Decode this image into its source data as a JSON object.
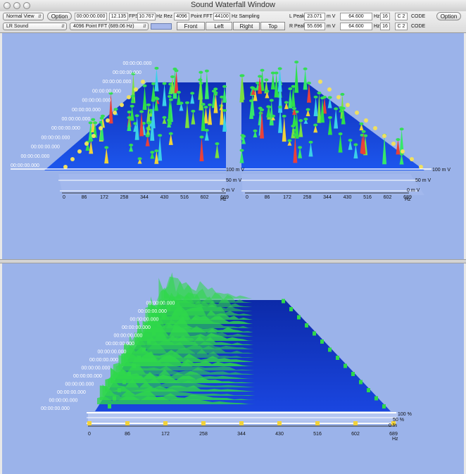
{
  "window": {
    "title": "Sound Waterfall Window"
  },
  "toolbar": {
    "view_mode": "Normal View",
    "option_left": "Option",
    "option_right": "Option",
    "time": "00:00:00.000",
    "fps_value": "12.135",
    "fps_unit": "FPS",
    "hz_rez_value": "10.767",
    "hz_rez_unit": "Hz Rez",
    "fft_points": "4096",
    "fft_unit": "Point FFT",
    "sampling_value": "44100",
    "sampling_unit": "Hz Sampling",
    "source": "LR Sound",
    "fft_select": "4096 Point FFT (689.06 Hz)",
    "views": [
      "Front",
      "Left",
      "Right",
      "Top"
    ],
    "l_peak_label": "L Peak",
    "l_peak_value": "23.071",
    "r_peak_label": "R Peak",
    "r_peak_value": "55.696",
    "mv_unit": "m V",
    "l_hz_value": "64.600",
    "r_hz_value": "64.600",
    "hz_unit": "Hz",
    "l_bands": "16",
    "r_bands": "16",
    "l_note": "C 2",
    "r_note": "C 2",
    "code_label": "CODE",
    "swatch_color": "#a7b8ea"
  },
  "top_plot": {
    "timestamp": "00:00:00.000",
    "x_ticks": [
      "0",
      "86",
      "172",
      "258",
      "344",
      "430",
      "516",
      "602",
      "689"
    ],
    "x_unit": "Hz",
    "level_labels": [
      "100 m V",
      "50 m V",
      "0 m V"
    ],
    "background_color": "#9bb3ea",
    "surface_color": "#1440d8"
  },
  "bottom_plot": {
    "timestamp": "00:00:00.000",
    "x_ticks": [
      "0",
      "86",
      "172",
      "258",
      "344",
      "430",
      "516",
      "602",
      "689"
    ],
    "x_unit": "Hz",
    "level_labels": [
      "100 %",
      "50 %",
      "0 %"
    ],
    "surface_color": "#1535d0",
    "peak_color": "#2fd84a"
  }
}
